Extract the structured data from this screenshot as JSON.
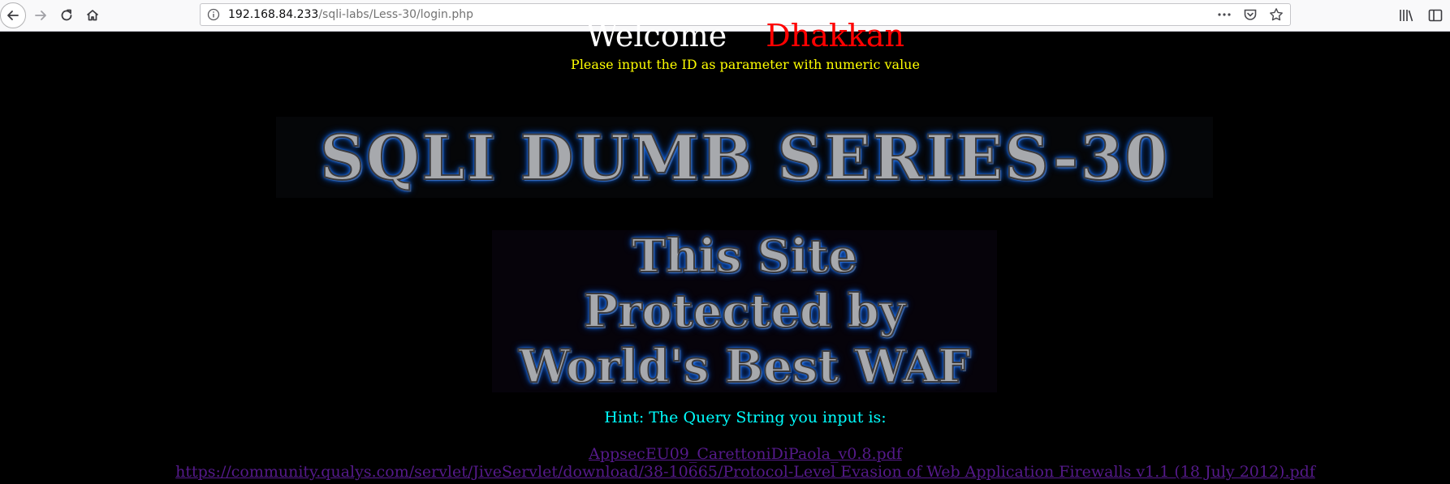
{
  "browser": {
    "url_host": "192.168.84.233",
    "url_path": "/sqli-labs/Less-30/login.php"
  },
  "page": {
    "welcome_word": "Welcome",
    "welcome_name": "Dhakkan",
    "prompt": "Please input the ID as parameter with numeric value",
    "banner_title": "SQLI DUMB SERIES-30",
    "waf_line1": "This Site",
    "waf_line2": "Protected by",
    "waf_line3": "World's Best WAF",
    "hint": "Hint: The Query String you input is:",
    "link1": "AppsecEU09_CarettoniDiPaola_v0.8.pdf",
    "link2": "https://community.qualys.com/servlet/JiveServlet/download/38-10665/Protocol-Level Evasion of Web Application Firewalls v1.1 (18 July 2012).pdf"
  },
  "colors": {
    "background": "#000000",
    "welcome_name": "#ff0000",
    "prompt": "#ffff00",
    "hint": "#00ffff",
    "link": "#551a8b",
    "glow": "#1e78ff"
  },
  "icons": [
    "back-icon",
    "forward-icon",
    "reload-icon",
    "home-icon",
    "info-icon",
    "more-icon",
    "pocket-icon",
    "bookmark-star-icon",
    "library-icon",
    "sidebar-icon"
  ]
}
